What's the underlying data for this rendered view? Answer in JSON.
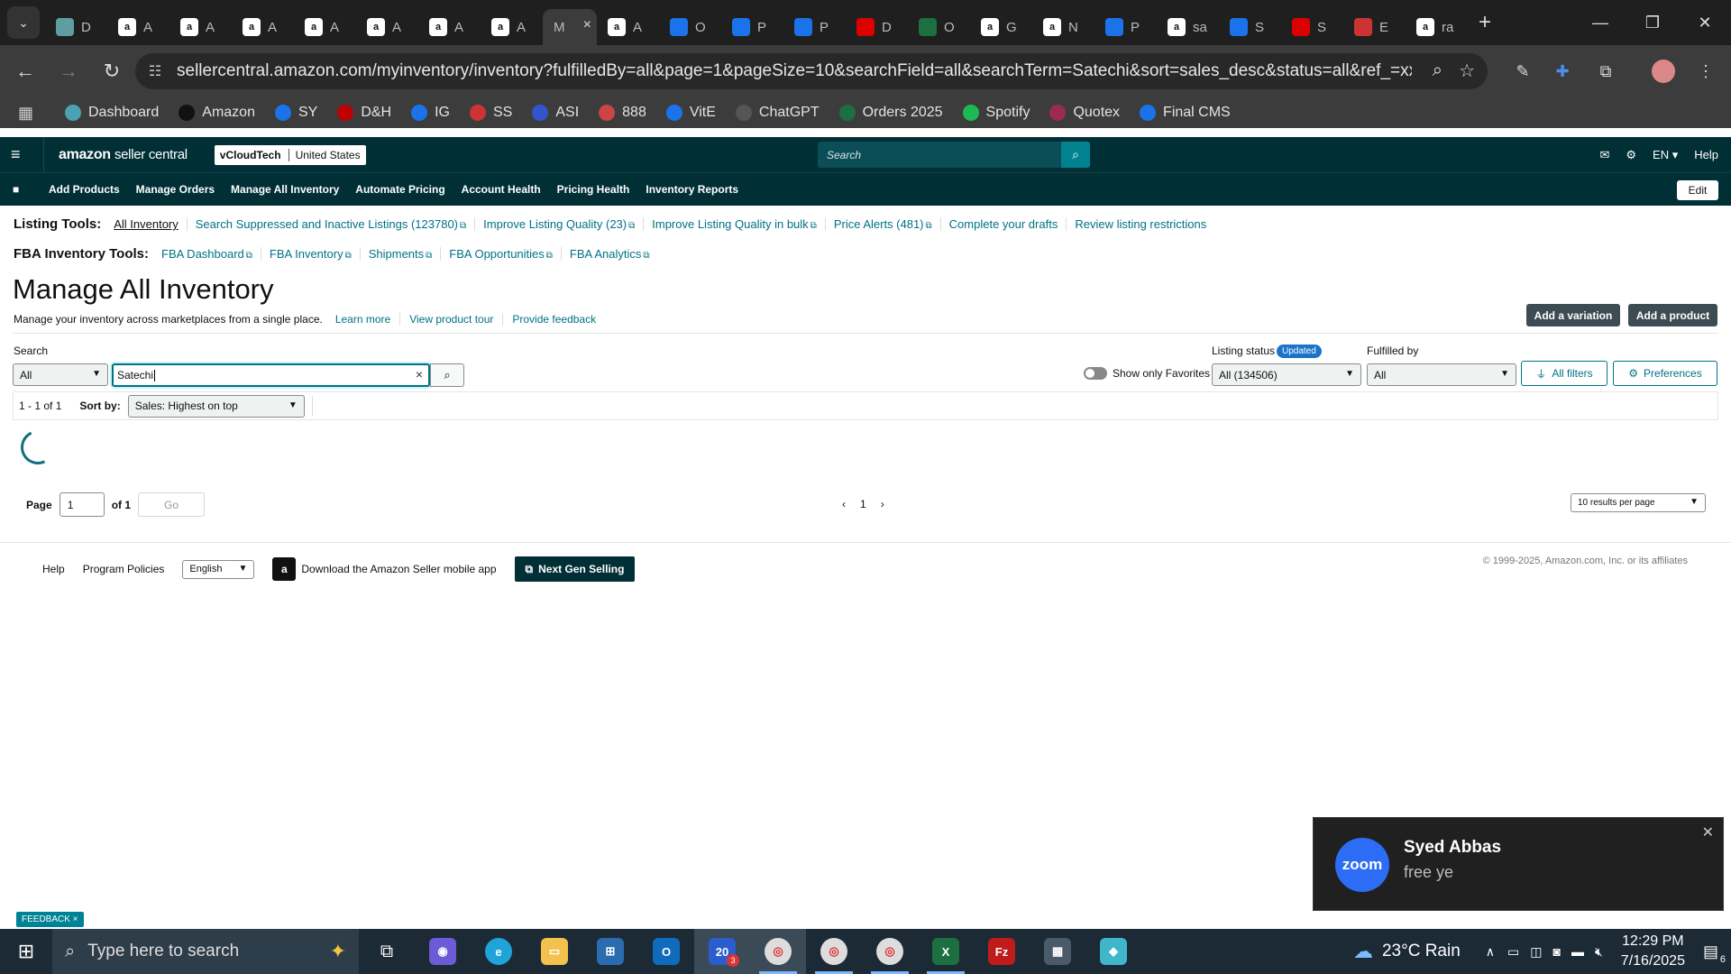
{
  "browser": {
    "tabs": [
      {
        "label": "D",
        "icon": "chevron-down-icon",
        "color": "#5f9ea0"
      },
      {
        "label": "A",
        "color": "#ffffff"
      },
      {
        "label": "A",
        "color": "#ffffff"
      },
      {
        "label": "A",
        "color": "#ffffff"
      },
      {
        "label": "A",
        "color": "#ffffff"
      },
      {
        "label": "A",
        "color": "#ffffff"
      },
      {
        "label": "A",
        "color": "#ffffff"
      },
      {
        "label": "A",
        "color": "#ffffff"
      },
      {
        "label": "M",
        "active": true
      },
      {
        "label": "A",
        "color": "#ffffff"
      },
      {
        "label": "O",
        "color": "#1a73e8"
      },
      {
        "label": "P",
        "color": "#1a73e8"
      },
      {
        "label": "P",
        "color": "#1a73e8"
      },
      {
        "label": "D",
        "color": "#d00"
      },
      {
        "label": "O",
        "color": "#1d6f42"
      },
      {
        "label": "G",
        "color": "#ffffff"
      },
      {
        "label": "N",
        "color": "#ffffff"
      },
      {
        "label": "P",
        "color": "#1a73e8"
      },
      {
        "label": "sa",
        "color": "#ffffff"
      },
      {
        "label": "S",
        "color": "#1a73e8"
      },
      {
        "label": "S",
        "color": "#d00"
      },
      {
        "label": "E",
        "color": "#c33"
      },
      {
        "label": "ra",
        "color": "#ffffff"
      }
    ],
    "url": "sellercentral.amazon.com/myinventory/inventory?fulfilledBy=all&page=1&pageSize=10&searchField=all&searchTerm=Satechi&sort=sales_desc&status=all&ref_=xx_invmgr_f...",
    "bookmarks": [
      {
        "label": "Dashboard",
        "color": "#4aa3b5"
      },
      {
        "label": "Amazon",
        "color": "#111111"
      },
      {
        "label": "SY",
        "color": "#1a73e8"
      },
      {
        "label": "D&H",
        "color": "#c00000"
      },
      {
        "label": "IG",
        "color": "#1a73e8"
      },
      {
        "label": "SS",
        "color": "#c33"
      },
      {
        "label": "ASI",
        "color": "#3355cc"
      },
      {
        "label": "888",
        "color": "#c44"
      },
      {
        "label": "VitE",
        "color": "#1a73e8"
      },
      {
        "label": "ChatGPT",
        "color": "#555555"
      },
      {
        "label": "Orders 2025",
        "color": "#1d6f42"
      },
      {
        "label": "Spotify",
        "color": "#1db954"
      },
      {
        "label": "Quotex",
        "color": "#9c2a55"
      },
      {
        "label": "Final CMS",
        "color": "#1a73e8"
      }
    ]
  },
  "header": {
    "logo_main": "amazon",
    "logo_sub": "seller central",
    "account": "vCloudTech",
    "marketplace": "United States",
    "search_placeholder": "Search",
    "language": "EN",
    "help": "Help"
  },
  "nav": {
    "items": [
      "Add Products",
      "Manage Orders",
      "Manage All Inventory",
      "Automate Pricing",
      "Account Health",
      "Pricing Health",
      "Inventory Reports"
    ],
    "edit": "Edit"
  },
  "listing_tools": {
    "label": "Listing Tools:",
    "links": [
      "All Inventory",
      "Search Suppressed and Inactive Listings (123780)",
      "Improve Listing Quality (23)",
      "Improve Listing Quality in bulk",
      "Price Alerts (481)",
      "Complete your drafts",
      "Review listing restrictions"
    ]
  },
  "fba_tools": {
    "label": "FBA Inventory Tools:",
    "links": [
      "FBA Dashboard",
      "FBA Inventory",
      "Shipments",
      "FBA Opportunities",
      "FBA Analytics"
    ]
  },
  "page": {
    "title": "Manage All Inventory",
    "description": "Manage your inventory across marketplaces from a single place.",
    "links": [
      "Learn more",
      "View product tour",
      "Provide feedback"
    ],
    "add_variation": "Add a variation",
    "add_product": "Add a product"
  },
  "filters": {
    "search_label": "Search",
    "search_field": "All",
    "search_value": "Satechi",
    "favorites_label": "Show only Favorites",
    "listing_status_label": "Listing status",
    "updated_badge": "Updated",
    "listing_status_value": "All (134506)",
    "fulfilled_label": "Fulfilled by",
    "fulfilled_value": "All",
    "all_filters": "All filters",
    "preferences": "Preferences"
  },
  "results": {
    "count": "1 - 1 of 1",
    "sort_label": "Sort by:",
    "sort_value": "Sales: Highest on top"
  },
  "pagination": {
    "page_label": "Page",
    "page_value": "1",
    "of_label": "of 1",
    "go": "Go",
    "current": "1",
    "per_page": "10 results per page"
  },
  "footer": {
    "help": "Help",
    "policies": "Program Policies",
    "language": "English",
    "app": "Download the Amazon Seller mobile app",
    "next_gen": "Next Gen Selling",
    "copyright": "© 1999-2025, Amazon.com, Inc. or its affiliates"
  },
  "toast": {
    "app": "zoom",
    "name": "Syed Abbas",
    "message": "free ye"
  },
  "feedback": "FEEDBACK",
  "taskbar": {
    "search_placeholder": "Type here to search",
    "weather": "23°C Rain",
    "time": "12:29 PM",
    "date": "7/16/2025",
    "notifications": "6",
    "badge": "3"
  }
}
